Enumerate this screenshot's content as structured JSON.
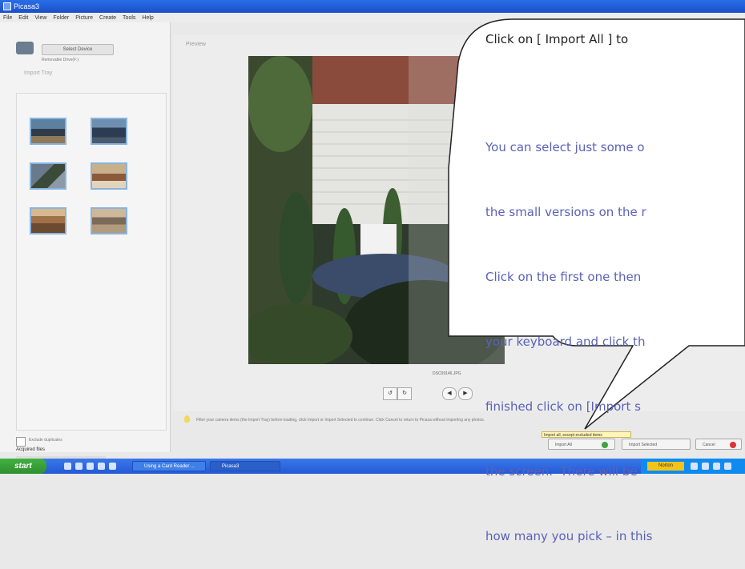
{
  "window": {
    "title": "Picasa3"
  },
  "menu": [
    "File",
    "Edit",
    "View",
    "Folder",
    "Picture",
    "Create",
    "Tools",
    "Help"
  ],
  "sidebar": {
    "device_select": "Select Device",
    "device_caption": "Removable Drive(F:)",
    "import_tray": "Import Tray",
    "exclude_label": "Exclude duplicates",
    "acquired_label": "Acquired files"
  },
  "preview": {
    "label": "Preview",
    "caption": "DSC09146.JPG",
    "hint": "Filter your camera items (the Import Tray) before loading, click Import or Import Selected to continue. Click Cancel to return to Picasa without importing any photos."
  },
  "buttons": {
    "tooltip": "Import all, except excluded items",
    "import_all": "Import All",
    "import_selected": "Import Selected",
    "cancel": "Cancel"
  },
  "taskbar": {
    "start": "start",
    "task_card_reader": "Using a Card Reader ...",
    "task_picasa": "Picasa3",
    "norton": "Norton"
  },
  "callout": {
    "heading": "Click on [  Import All  ] to",
    "body_lines": [
      "You can select just some o",
      "the small versions on the r",
      "Click on the first one then",
      "your keyboard and click th",
      "finished click on [Import s",
      "the screen.  There will be",
      "how many you pick – in this"
    ]
  }
}
